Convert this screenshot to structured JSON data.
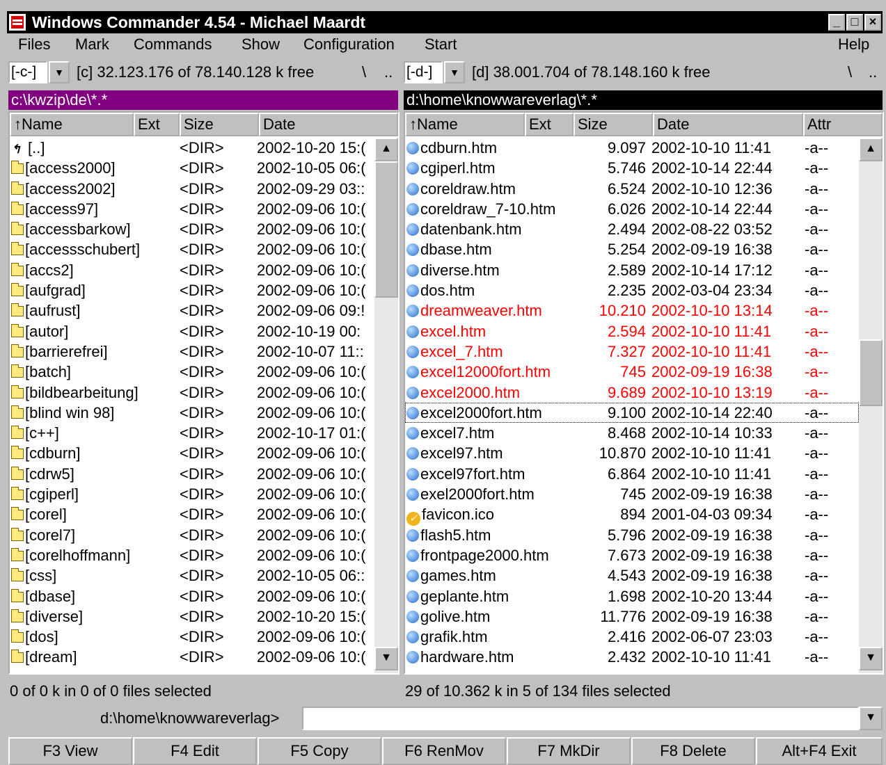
{
  "window": {
    "title": "Windows Commander 4.54 - Michael Maardt",
    "min": "_",
    "max": "□",
    "close": "×"
  },
  "menu": [
    "Files",
    "Mark",
    "Commands",
    "Show",
    "Configuration",
    "Start",
    "Help"
  ],
  "left_drive": {
    "select": "[-c-]",
    "drop": "▼",
    "info": "[c]  32.123.176 of 78.140.128 k free",
    "root": "\\",
    "up": ".."
  },
  "right_drive": {
    "select": "[-d-]",
    "drop": "▼",
    "info": "[d]  38.001.704 of 78.148.160 k free",
    "root": "\\",
    "up": ".."
  },
  "left_panel": {
    "path": "c:\\kwzip\\de\\*.*",
    "path_color": "#800080",
    "columns": [
      "↑Name",
      "Ext",
      "Size",
      "Date"
    ],
    "rows": [
      {
        "name": "[..]",
        "size": "<DIR>",
        "date": "2002-10-20 15:(",
        "up": true
      },
      {
        "name": "[access2000]",
        "size": "<DIR>",
        "date": "2002-10-05 06:("
      },
      {
        "name": "[access2002]",
        "size": "<DIR>",
        "date": "2002-09-29 03::"
      },
      {
        "name": "[access97]",
        "size": "<DIR>",
        "date": "2002-09-06 10:("
      },
      {
        "name": "[accessbarkow]",
        "size": "<DIR>",
        "date": "2002-09-06 10:("
      },
      {
        "name": "[accessschubert]",
        "size": "<DIR>",
        "date": "2002-09-06 10:("
      },
      {
        "name": "[accs2]",
        "size": "<DIR>",
        "date": "2002-09-06 10:("
      },
      {
        "name": "[aufgrad]",
        "size": "<DIR>",
        "date": "2002-09-06 10:("
      },
      {
        "name": "[aufrust]",
        "size": "<DIR>",
        "date": "2002-09-06 09:!"
      },
      {
        "name": "[autor]",
        "size": "<DIR>",
        "date": "2002-10-19 00:"
      },
      {
        "name": "[barrierefrei]",
        "size": "<DIR>",
        "date": "2002-10-07 11::"
      },
      {
        "name": "[batch]",
        "size": "<DIR>",
        "date": "2002-09-06 10:("
      },
      {
        "name": "[bildbearbeitung]",
        "size": "<DIR>",
        "date": "2002-09-06 10:("
      },
      {
        "name": "[blind win 98]",
        "size": "<DIR>",
        "date": "2002-09-06 10:("
      },
      {
        "name": "[c++]",
        "size": "<DIR>",
        "date": "2002-10-17 01:("
      },
      {
        "name": "[cdburn]",
        "size": "<DIR>",
        "date": "2002-09-06 10:("
      },
      {
        "name": "[cdrw5]",
        "size": "<DIR>",
        "date": "2002-09-06 10:("
      },
      {
        "name": "[cgiperl]",
        "size": "<DIR>",
        "date": "2002-09-06 10:("
      },
      {
        "name": "[corel]",
        "size": "<DIR>",
        "date": "2002-09-06 10:("
      },
      {
        "name": "[corel7]",
        "size": "<DIR>",
        "date": "2002-09-06 10:("
      },
      {
        "name": "[corelhoffmann]",
        "size": "<DIR>",
        "date": "2002-09-06 10:("
      },
      {
        "name": "[css]",
        "size": "<DIR>",
        "date": "2002-10-05 06::"
      },
      {
        "name": "[dbase]",
        "size": "<DIR>",
        "date": "2002-09-06 10:("
      },
      {
        "name": "[diverse]",
        "size": "<DIR>",
        "date": "2002-10-20 15:("
      },
      {
        "name": "[dos]",
        "size": "<DIR>",
        "date": "2002-09-06 10:("
      },
      {
        "name": "[dream]",
        "size": "<DIR>",
        "date": "2002-09-06 10:("
      }
    ],
    "status": "0 of 0 k in 0 of 0 files selected"
  },
  "right_panel": {
    "path": "d:\\home\\knowwareverlag\\*.*",
    "path_color": "#000000",
    "columns": [
      "↑Name",
      "Ext",
      "Size",
      "Date",
      "Attr"
    ],
    "rows": [
      {
        "name": "cdburn.htm",
        "size": "9.097",
        "date": "2002-10-10 11:41",
        "attr": "-a--"
      },
      {
        "name": "cgiperl.htm",
        "size": "5.746",
        "date": "2002-10-14 22:44",
        "attr": "-a--"
      },
      {
        "name": "coreldraw.htm",
        "size": "6.524",
        "date": "2002-10-10 12:36",
        "attr": "-a--"
      },
      {
        "name": "coreldraw_7-10.htm",
        "size": "6.026",
        "date": "2002-10-14 22:44",
        "attr": "-a--"
      },
      {
        "name": "datenbank.htm",
        "size": "2.494",
        "date": "2002-08-22 03:52",
        "attr": "-a--"
      },
      {
        "name": "dbase.htm",
        "size": "5.254",
        "date": "2002-09-19 16:38",
        "attr": "-a--"
      },
      {
        "name": "diverse.htm",
        "size": "2.589",
        "date": "2002-10-14 17:12",
        "attr": "-a--"
      },
      {
        "name": "dos.htm",
        "size": "2.235",
        "date": "2002-03-04 23:34",
        "attr": "-a--"
      },
      {
        "name": "dreamweaver.htm",
        "size": "10.210",
        "date": "2002-10-10 13:14",
        "attr": "-a--",
        "sel": true
      },
      {
        "name": "excel.htm",
        "size": "2.594",
        "date": "2002-10-10 11:41",
        "attr": "-a--",
        "sel": true
      },
      {
        "name": "excel_7.htm",
        "size": "7.327",
        "date": "2002-10-10 11:41",
        "attr": "-a--",
        "sel": true
      },
      {
        "name": "excel12000fort.htm",
        "size": "745",
        "date": "2002-09-19 16:38",
        "attr": "-a--",
        "sel": true
      },
      {
        "name": "excel2000.htm",
        "size": "9.689",
        "date": "2002-10-10 13:19",
        "attr": "-a--",
        "sel": true
      },
      {
        "name": "excel2000fort.htm",
        "size": "9.100",
        "date": "2002-10-14 22:40",
        "attr": "-a--",
        "focus": true
      },
      {
        "name": "excel7.htm",
        "size": "8.468",
        "date": "2002-10-14 10:33",
        "attr": "-a--"
      },
      {
        "name": "excel97.htm",
        "size": "10.870",
        "date": "2002-10-10 11:41",
        "attr": "-a--"
      },
      {
        "name": "excel97fort.htm",
        "size": "6.864",
        "date": "2002-10-10 11:41",
        "attr": "-a--"
      },
      {
        "name": "exel2000fort.htm",
        "size": "745",
        "date": "2002-09-19 16:38",
        "attr": "-a--"
      },
      {
        "name": "favicon.ico",
        "size": "894",
        "date": "2001-04-03 09:34",
        "attr": "-a--",
        "ico": true
      },
      {
        "name": "flash5.htm",
        "size": "5.796",
        "date": "2002-09-19 16:38",
        "attr": "-a--"
      },
      {
        "name": "frontpage2000.htm",
        "size": "7.673",
        "date": "2002-09-19 16:38",
        "attr": "-a--"
      },
      {
        "name": "games.htm",
        "size": "4.543",
        "date": "2002-09-19 16:38",
        "attr": "-a--"
      },
      {
        "name": "geplante.htm",
        "size": "1.698",
        "date": "2002-10-20 13:44",
        "attr": "-a--"
      },
      {
        "name": "golive.htm",
        "size": "11.776",
        "date": "2002-09-19 16:38",
        "attr": "-a--"
      },
      {
        "name": "grafik.htm",
        "size": "2.416",
        "date": "2002-06-07 23:03",
        "attr": "-a--"
      },
      {
        "name": "hardware.htm",
        "size": "2.432",
        "date": "2002-10-10 11:41",
        "attr": "-a--"
      }
    ],
    "status": "29 of 10.362 k in 5 of 134 files selected"
  },
  "command_line": {
    "prompt": "d:\\home\\knowwareverlag>",
    "value": ""
  },
  "function_keys": [
    "F3 View",
    "F4 Edit",
    "F5 Copy",
    "F6 RenMov",
    "F7 MkDir",
    "F8 Delete",
    "Alt+F4 Exit"
  ],
  "colors": {
    "selected_text": "#ff0000",
    "left_path_bg": "#800080",
    "right_path_bg": "#000000"
  }
}
